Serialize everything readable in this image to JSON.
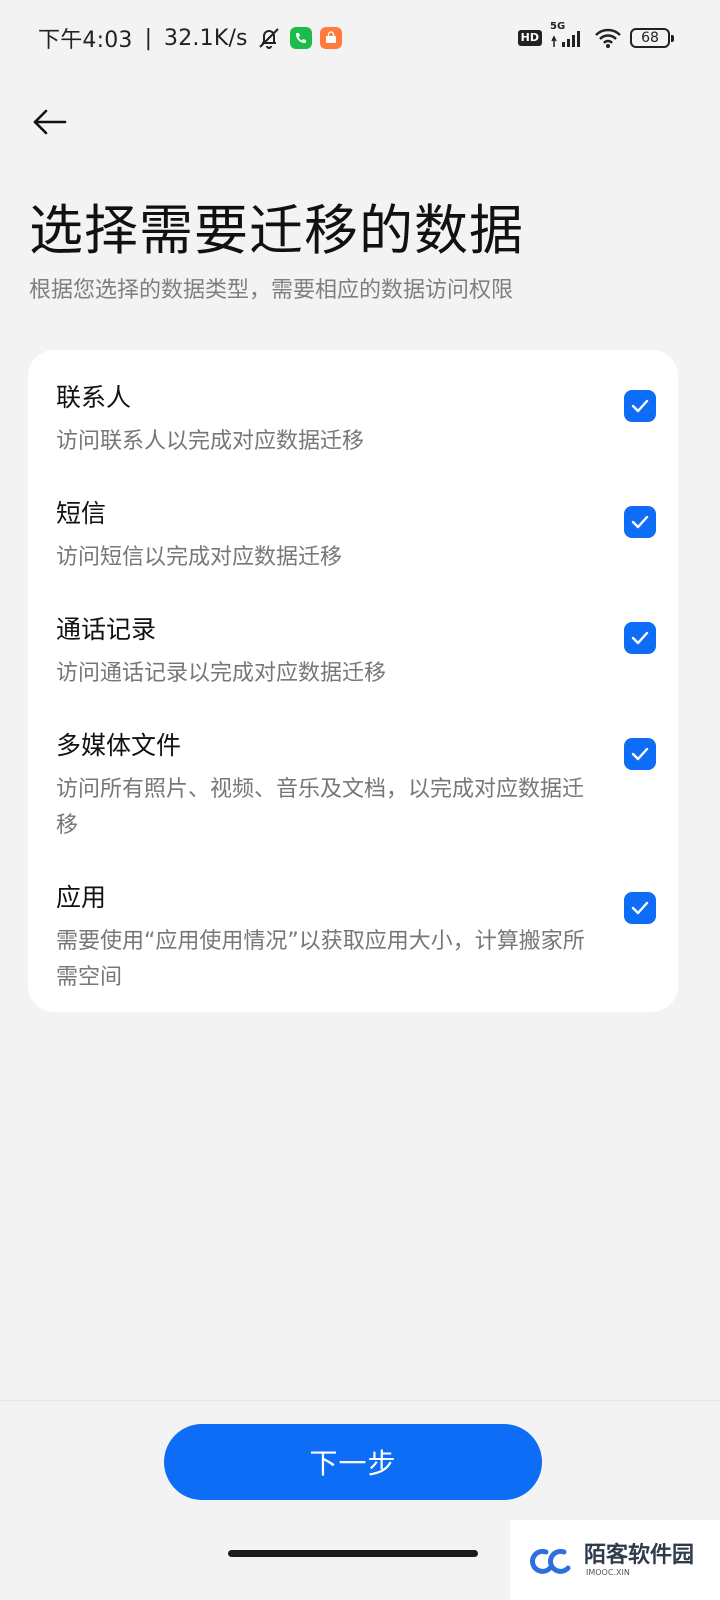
{
  "status_bar": {
    "time": "下午4:03",
    "separator": "|",
    "speed": "32.1K/s",
    "hd": "HD",
    "network": "5G",
    "battery": "68",
    "icons": [
      "mute-bell-icon",
      "phone-app-icon",
      "store-app-icon",
      "signal-icon",
      "wifi-icon",
      "battery-icon"
    ]
  },
  "header": {
    "back_icon": "arrow-left-icon",
    "title": "选择需要迁移的数据",
    "subtitle": "根据您选择的数据类型，需要相应的数据访问权限"
  },
  "items": [
    {
      "title": "联系人",
      "desc": "访问联系人以完成对应数据迁移",
      "checked": true
    },
    {
      "title": "短信",
      "desc": "访问短信以完成对应数据迁移",
      "checked": true
    },
    {
      "title": "通话记录",
      "desc": "访问通话记录以完成对应数据迁移",
      "checked": true
    },
    {
      "title": "多媒体文件",
      "desc": "访问所有照片、视频、音乐及文档，以完成对应数据迁移",
      "checked": true
    },
    {
      "title": "应用",
      "desc": "需要使用“应用使用情况”以获取应用大小，计算搬家所需空间",
      "checked": true
    }
  ],
  "footer": {
    "next_label": "下一步"
  },
  "watermark": {
    "title": "陌客软件园",
    "sub": "IMOOC.XIN"
  },
  "colors": {
    "accent": "#0d6df6",
    "background": "#f3f3f3",
    "card": "#ffffff"
  }
}
